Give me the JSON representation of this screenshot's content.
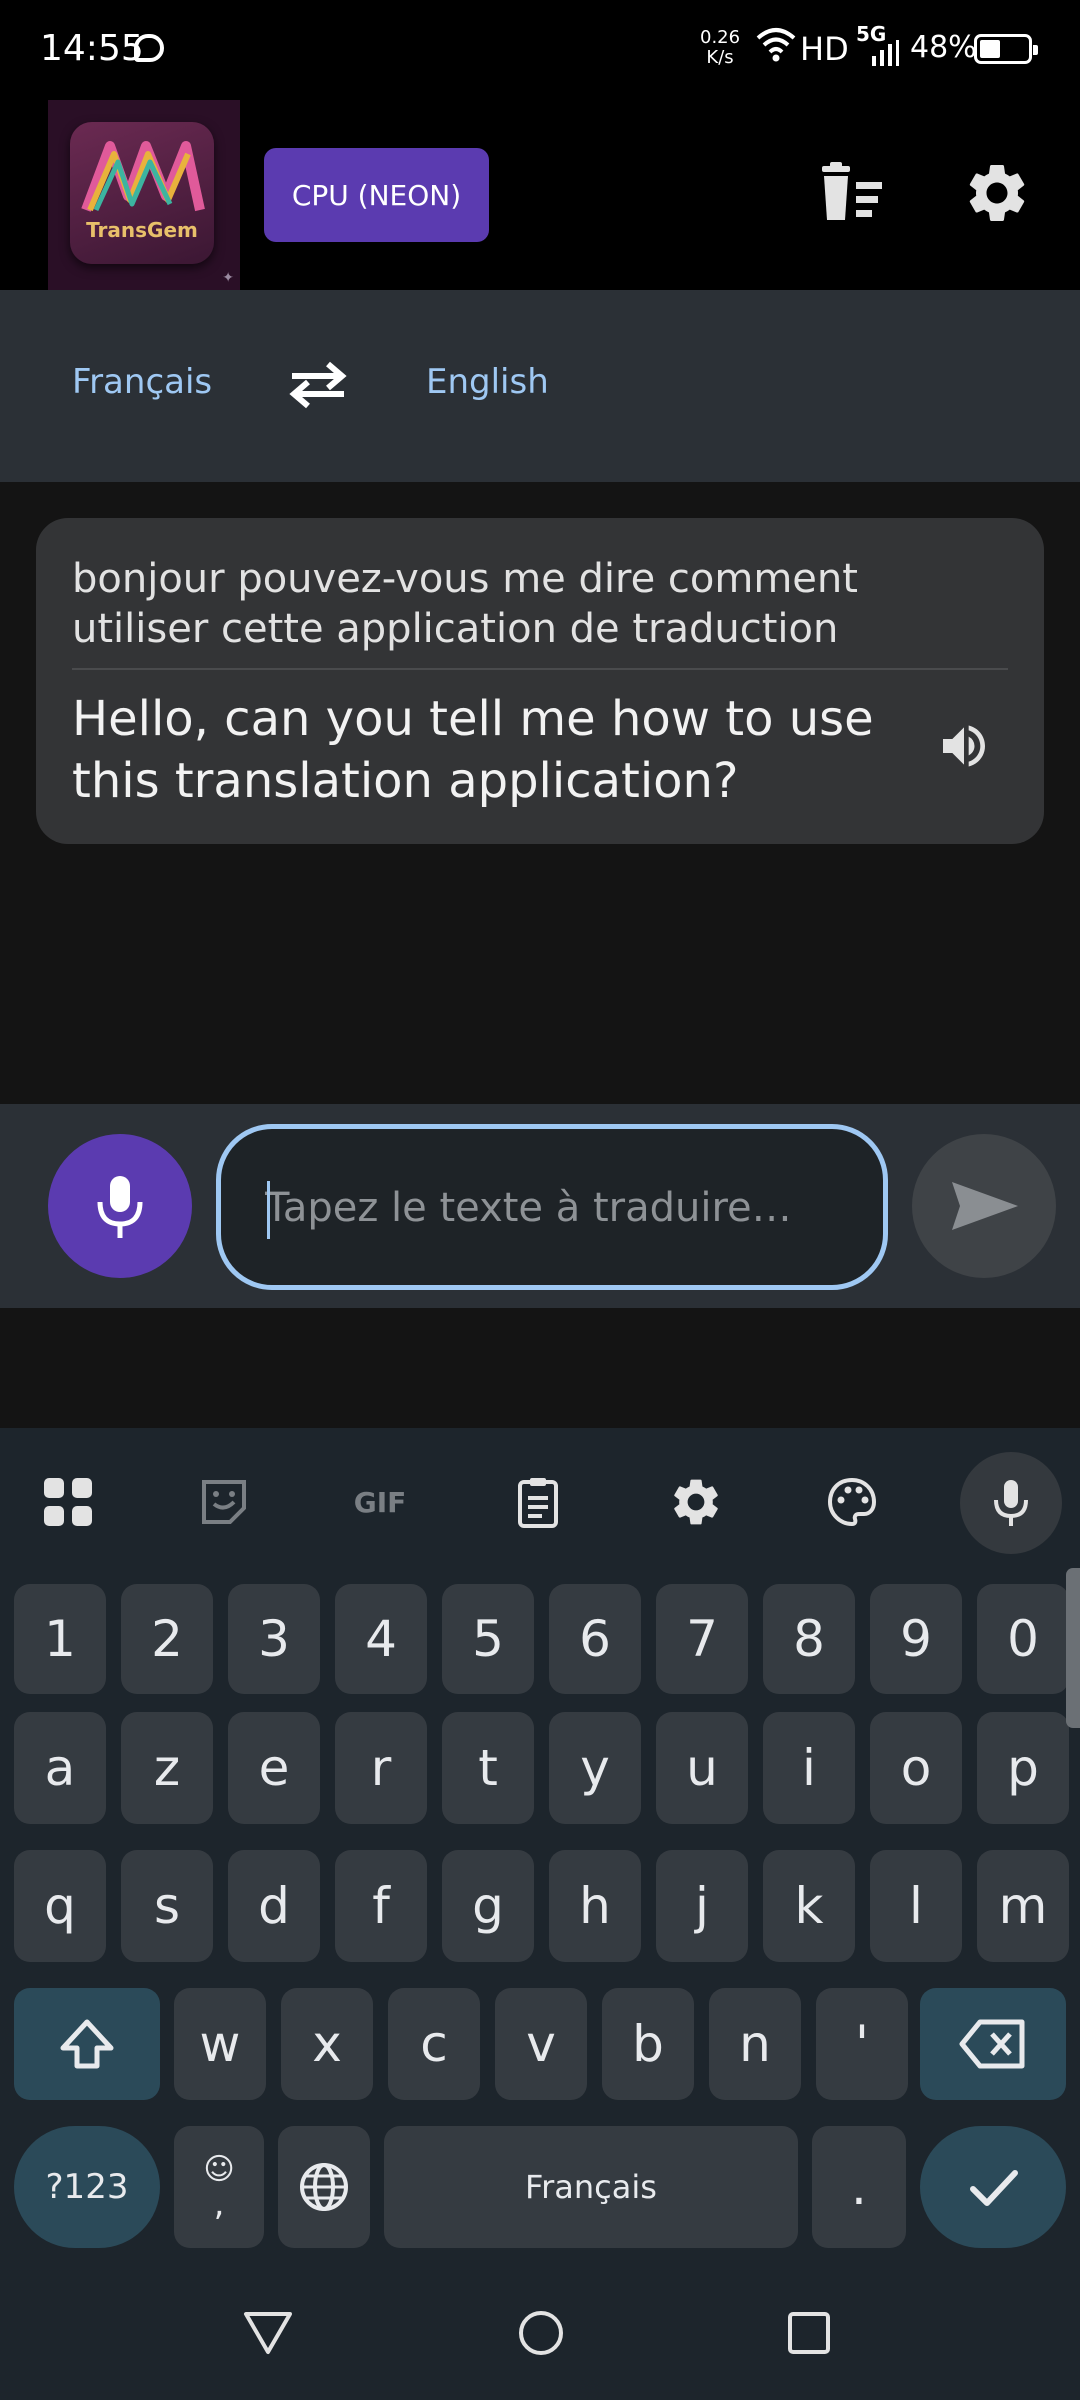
{
  "status_bar": {
    "time": "14:55",
    "net_speed_value": "0.26",
    "net_speed_unit": "K/s",
    "hd": "HD",
    "network": "5G",
    "battery": "48%"
  },
  "header": {
    "logo_text": "TransGem",
    "cpu_label": "CPU (NEON)"
  },
  "languages": {
    "source": "Français",
    "target": "English"
  },
  "translation": {
    "source_text": "bonjour pouvez-vous me dire comment utiliser cette application de traduction",
    "translated_text": "Hello, can you tell me how to use this translation application?"
  },
  "input": {
    "placeholder": "Tapez le texte à traduire…",
    "value": ""
  },
  "keyboard": {
    "toolbar": [
      "apps-grid-icon",
      "sticker-icon",
      "gif-icon",
      "clipboard-icon",
      "settings-icon",
      "palette-icon",
      "mic-icon"
    ],
    "gif_label": "GIF",
    "row_numbers": [
      "1",
      "2",
      "3",
      "4",
      "5",
      "6",
      "7",
      "8",
      "9",
      "0"
    ],
    "row1": [
      "a",
      "z",
      "e",
      "r",
      "t",
      "y",
      "u",
      "i",
      "o",
      "p"
    ],
    "row2": [
      "q",
      "s",
      "d",
      "f",
      "g",
      "h",
      "j",
      "k",
      "l",
      "m"
    ],
    "row3": [
      "w",
      "x",
      "c",
      "v",
      "b",
      "n",
      "'"
    ],
    "symbols_label": "?123",
    "emoji_comma": ",",
    "space_label": "Français",
    "period": "."
  },
  "colors": {
    "accent_purple": "#5b3bb0",
    "link_blue": "#9fc8f3",
    "card_bg": "#333436",
    "keyboard_bg": "#1d252c"
  }
}
